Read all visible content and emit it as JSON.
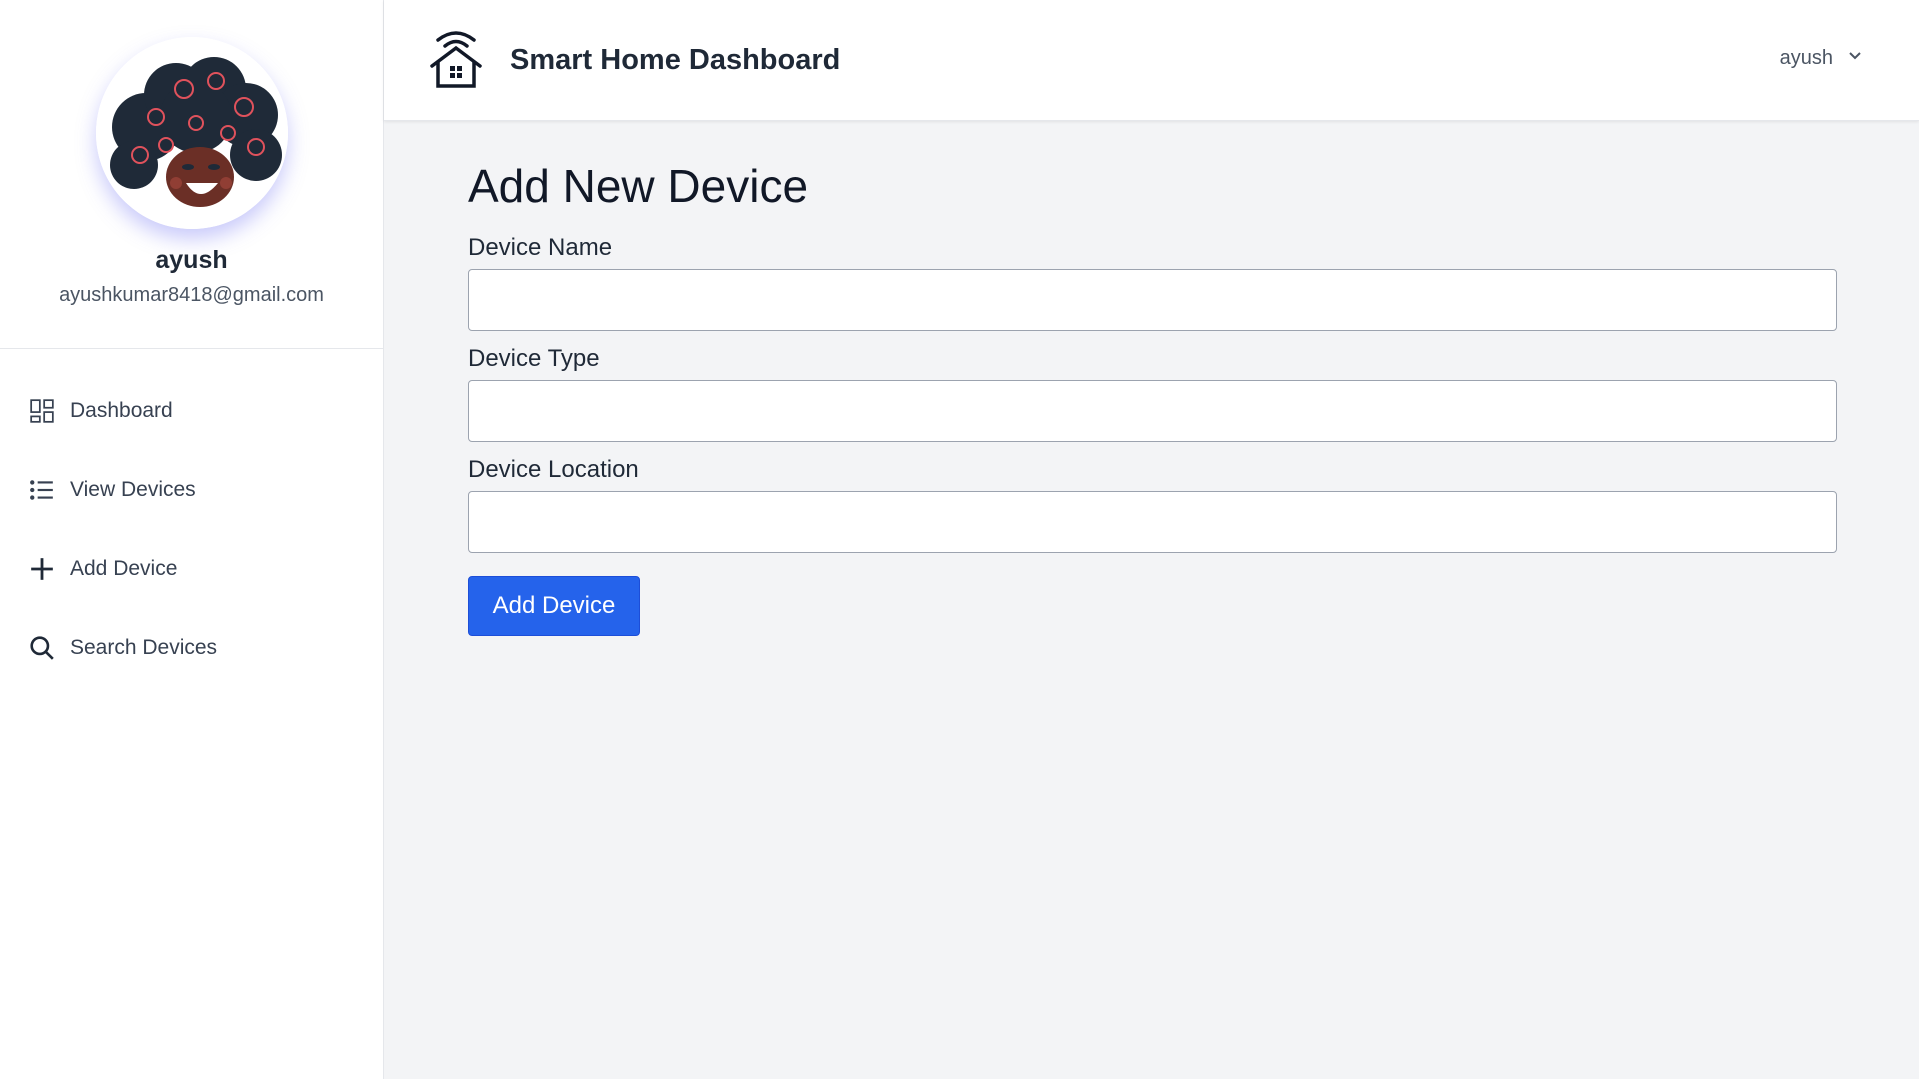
{
  "header": {
    "app_title": "Smart Home Dashboard",
    "user_menu_label": "ayush"
  },
  "profile": {
    "name": "ayush",
    "email": "ayushkumar8418@gmail.com"
  },
  "sidebar": {
    "items": [
      {
        "label": "Dashboard",
        "icon": "grid-icon"
      },
      {
        "label": "View Devices",
        "icon": "list-icon"
      },
      {
        "label": "Add Device",
        "icon": "plus-icon"
      },
      {
        "label": "Search Devices",
        "icon": "search-icon"
      }
    ]
  },
  "form": {
    "title": "Add New Device",
    "fields": [
      {
        "label": "Device Name",
        "value": "",
        "placeholder": ""
      },
      {
        "label": "Device Type",
        "value": "",
        "placeholder": ""
      },
      {
        "label": "Device Location",
        "value": "",
        "placeholder": ""
      }
    ],
    "submit_label": "Add Device"
  },
  "colors": {
    "accent": "#2563eb",
    "sidebar_bg": "#ffffff",
    "content_bg": "#f3f4f6"
  }
}
